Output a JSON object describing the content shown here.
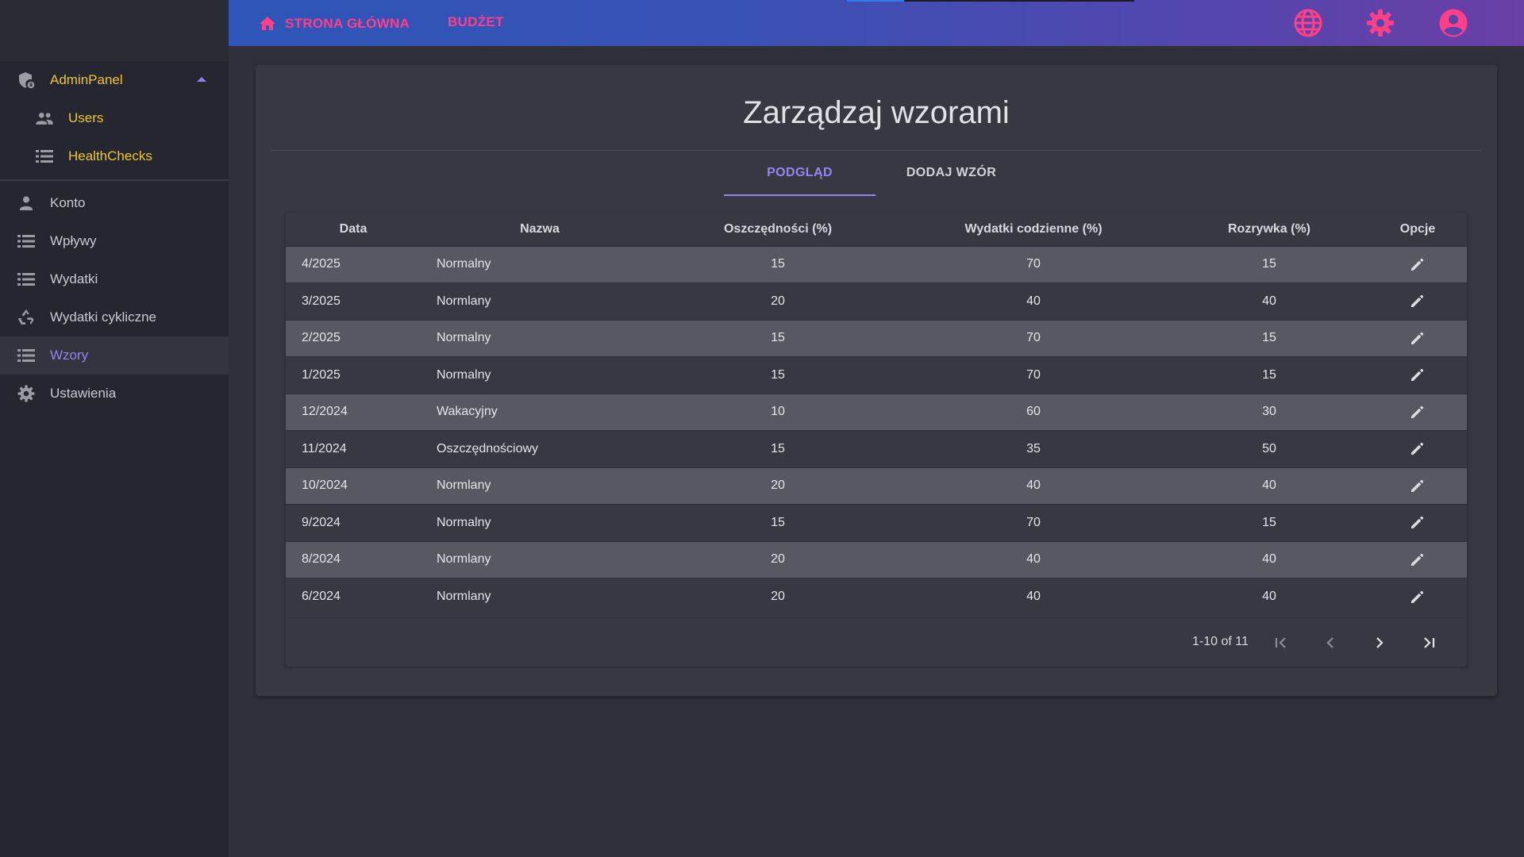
{
  "colors": {
    "accent": "#8f86f2",
    "gold": "#f0c52e",
    "pink": "#ff3f87",
    "sidebar": "#262630",
    "card": "#383843",
    "row_stripe": "#585862"
  },
  "topbar": {
    "home_label": "STRONA GŁÓWNA",
    "budget_label": "BUDŻET",
    "icons": [
      "home-icon",
      "globe-icon",
      "gear-icon",
      "account-circle-icon"
    ]
  },
  "sidebar": {
    "admin": {
      "label": "AdminPanel",
      "icon": "shield-lock-icon",
      "expanded": true
    },
    "admin_items": [
      {
        "label": "Users",
        "icon": "group-icon"
      },
      {
        "label": "HealthChecks",
        "icon": "list-icon"
      }
    ],
    "items": [
      {
        "label": "Konto",
        "icon": "person-icon"
      },
      {
        "label": "Wpływy",
        "icon": "list-icon"
      },
      {
        "label": "Wydatki",
        "icon": "list-icon"
      },
      {
        "label": "Wydatki cykliczne",
        "icon": "recycle-icon"
      },
      {
        "label": "Wzory",
        "icon": "list-icon",
        "active": true
      },
      {
        "label": "Ustawienia",
        "icon": "gear-icon"
      }
    ]
  },
  "main": {
    "title": "Zarządzaj wzorami",
    "tabs": [
      {
        "label": "PODGLĄD",
        "active": true
      },
      {
        "label": "DODAJ WZÓR",
        "active": false
      }
    ],
    "table": {
      "headers": [
        "Data",
        "Nazwa",
        "Oszczędności (%)",
        "Wydatki codzienne (%)",
        "Rozrywka (%)",
        "Opcje"
      ],
      "rows": [
        [
          "4/2025",
          "Normalny",
          "15",
          "70",
          "15"
        ],
        [
          "3/2025",
          "Normlany",
          "20",
          "40",
          "40"
        ],
        [
          "2/2025",
          "Normalny",
          "15",
          "70",
          "15"
        ],
        [
          "1/2025",
          "Normalny",
          "15",
          "70",
          "15"
        ],
        [
          "12/2024",
          "Wakacyjny",
          "10",
          "60",
          "30"
        ],
        [
          "11/2024",
          "Oszczędnościowy",
          "15",
          "35",
          "50"
        ],
        [
          "10/2024",
          "Normlany",
          "20",
          "40",
          "40"
        ],
        [
          "9/2024",
          "Normalny",
          "15",
          "70",
          "15"
        ],
        [
          "8/2024",
          "Normlany",
          "20",
          "40",
          "40"
        ],
        [
          "6/2024",
          "Normlany",
          "20",
          "40",
          "40"
        ]
      ],
      "row_action_icon": "pencil-icon"
    },
    "paginator": {
      "range_label": "1-10 of 11",
      "icons": [
        "first-page-icon",
        "prev-page-icon",
        "next-page-icon",
        "last-page-icon"
      ]
    }
  }
}
